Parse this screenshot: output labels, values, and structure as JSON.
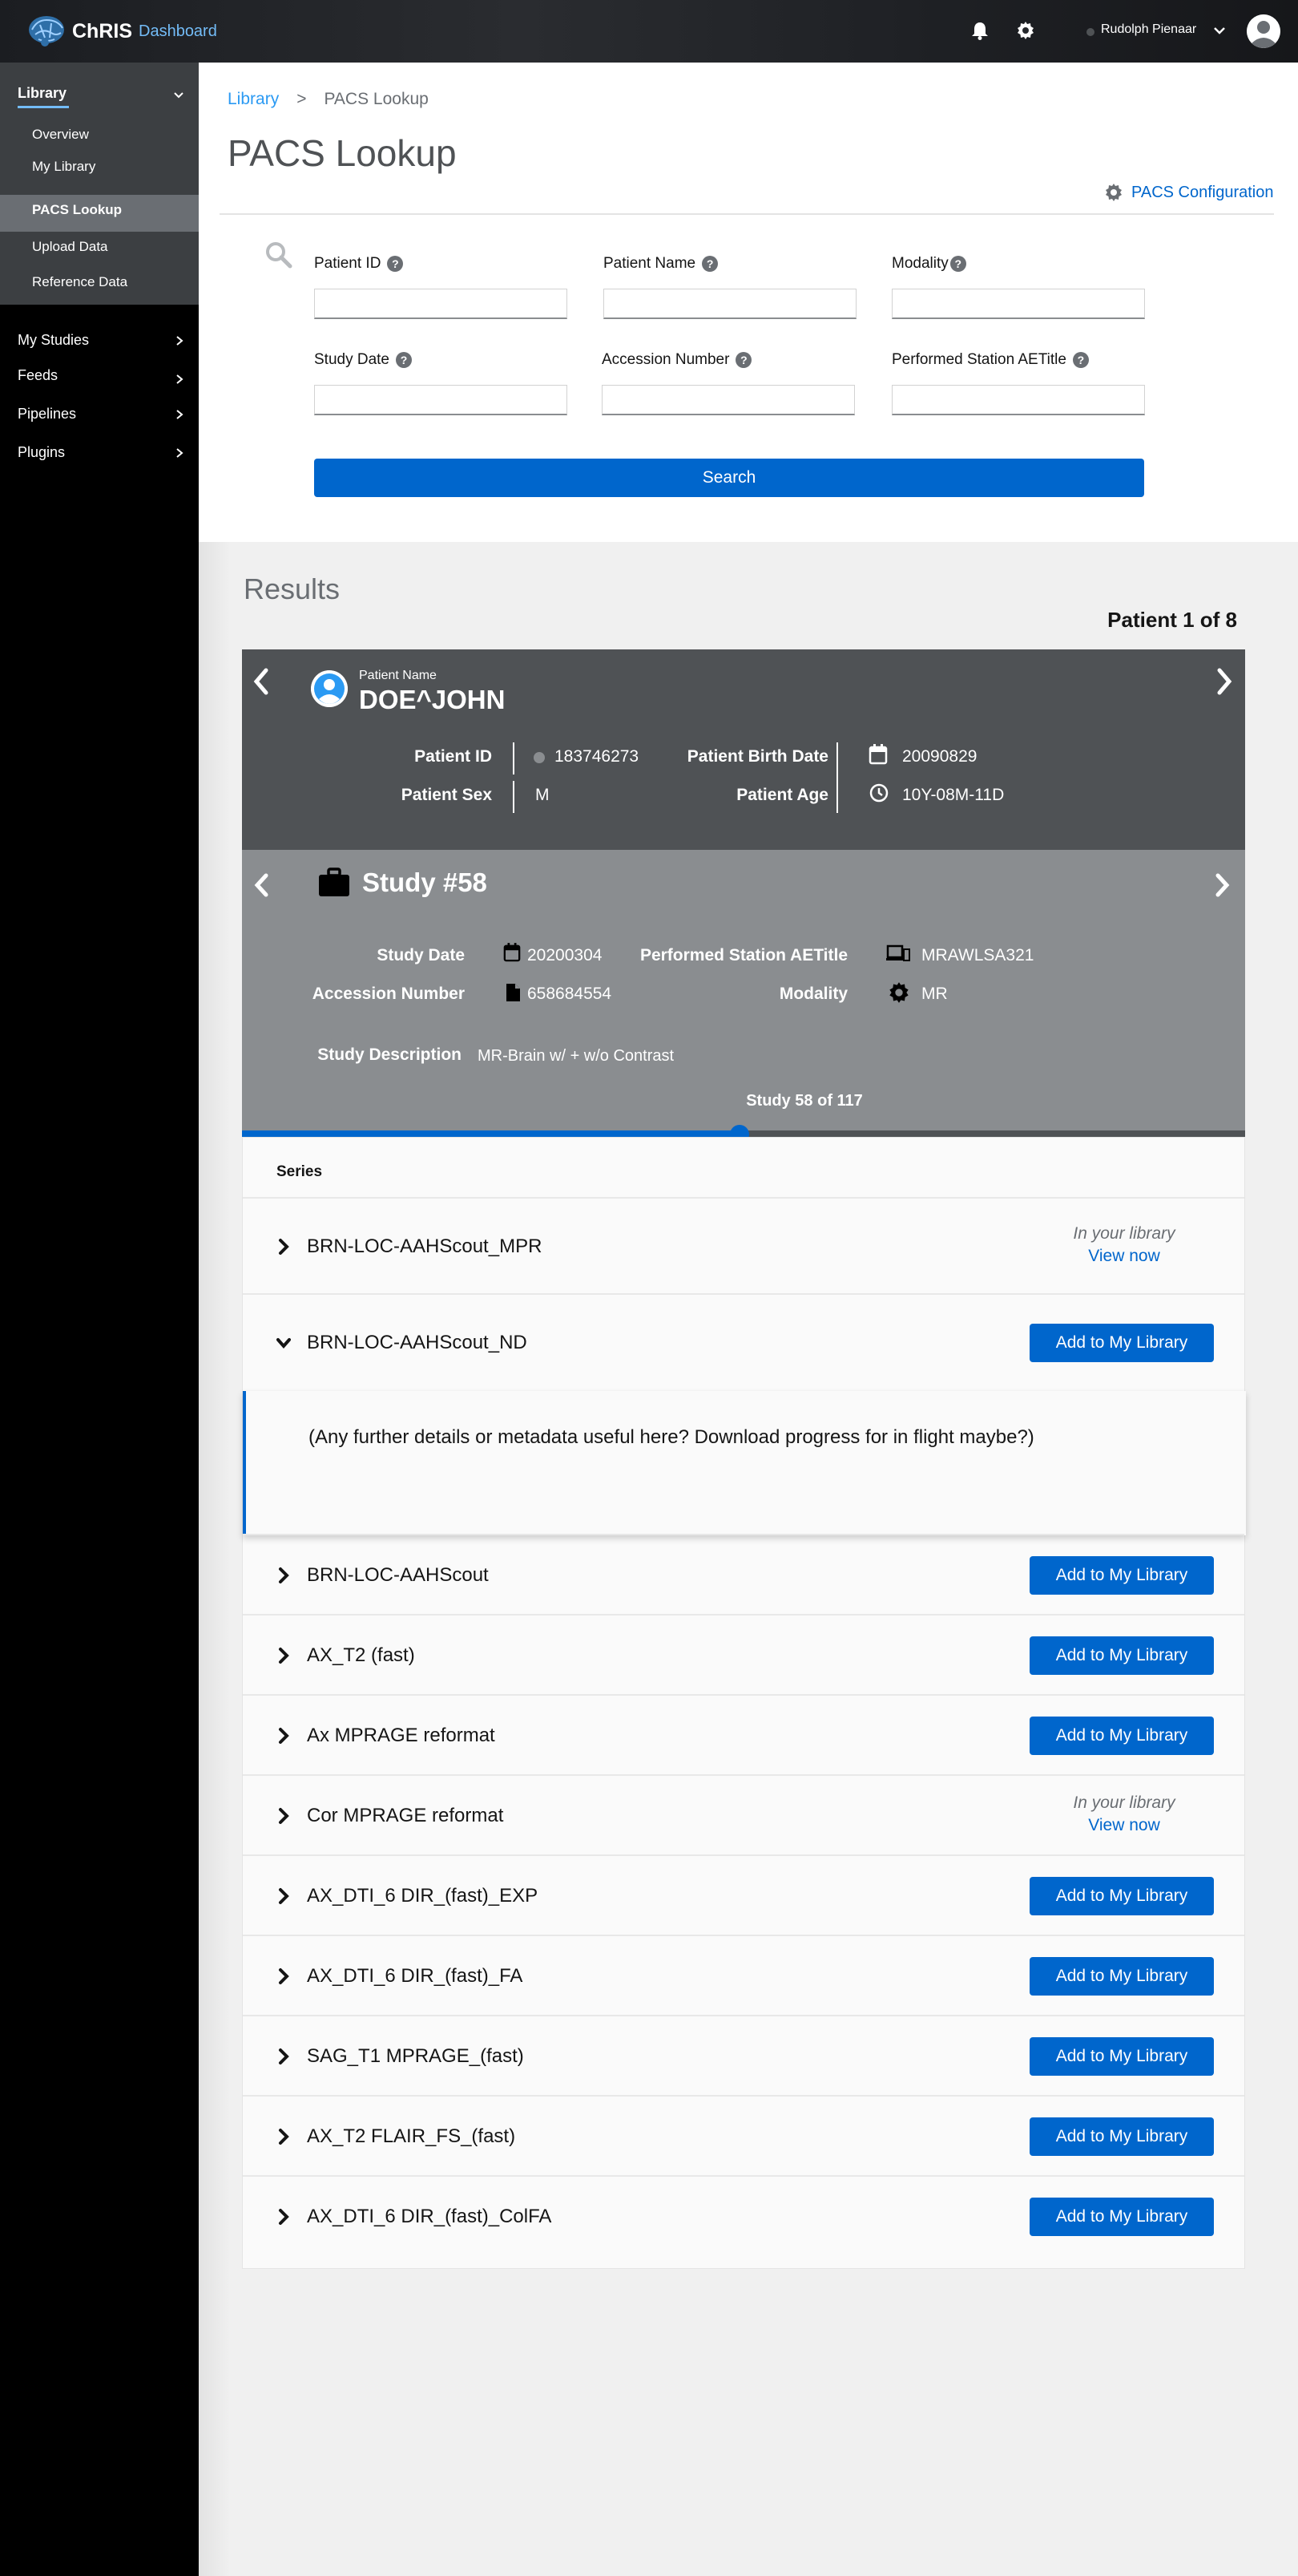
{
  "topbar": {
    "brand_name": "ChRIS",
    "brand_sub": "Dashboard",
    "user_name": "Rudolph Pienaar"
  },
  "sidebar": {
    "group_label": "Library",
    "sub_items": [
      "Overview",
      "My Library",
      "PACS Lookup",
      "Upload Data",
      "Reference Data"
    ],
    "active_item": "PACS Lookup",
    "main_items": [
      "My Studies",
      "Feeds",
      "Pipelines",
      "Plugins"
    ]
  },
  "breadcrumb": {
    "root": "Library",
    "separator": ">",
    "current": "PACS Lookup"
  },
  "page": {
    "title": "PACS Lookup",
    "config_link": "PACS Configuration"
  },
  "form": {
    "patient_id": {
      "label": "Patient ID",
      "value": ""
    },
    "patient_name": {
      "label": "Patient Name",
      "value": ""
    },
    "modality": {
      "label": "Modality",
      "value": ""
    },
    "study_date": {
      "label": "Study Date",
      "value": ""
    },
    "accession_number": {
      "label": "Accession Number",
      "value": ""
    },
    "station_aetitle": {
      "label": "Performed Station AETitle",
      "value": ""
    },
    "help_glyph": "?",
    "search_label": "Search"
  },
  "results": {
    "title": "Results",
    "patient_count": "Patient 1 of 8"
  },
  "patient": {
    "name_label": "Patient Name",
    "name": "DOE^JOHN",
    "id_label": "Patient ID",
    "id": "183746273",
    "birth_label": "Patient Birth Date",
    "birth": "20090829",
    "sex_label": "Patient Sex",
    "sex": "M",
    "age_label": "Patient Age",
    "age": "10Y-08M-11D"
  },
  "study": {
    "title": "Study #58",
    "date_label": "Study Date",
    "date": "20200304",
    "station_label": "Performed Station AETitle",
    "station": "MRAWLSA321",
    "accession_label": "Accession Number",
    "accession": "658684554",
    "modality_label": "Modality",
    "modality": "MR",
    "desc_label": "Study Description",
    "desc": "MR-Brain w/ + w/o Contrast",
    "count_text": "Study 58 of 117",
    "progress_fraction": 0.4957
  },
  "series": {
    "header": "Series",
    "add_label": "Add to My Library",
    "in_library_label": "In your library",
    "view_now_label": "View now",
    "details_text": "(Any further details or metadata useful here? Download progress for in flight maybe?)",
    "items": [
      {
        "name": "BRN-LOC-AAHScout_MPR",
        "in_library": true,
        "expanded": false
      },
      {
        "name": "BRN-LOC-AAHScout_ND",
        "in_library": false,
        "expanded": true
      },
      {
        "name": "BRN-LOC-AAHScout",
        "in_library": false,
        "expanded": false
      },
      {
        "name": "AX_T2 (fast)",
        "in_library": false,
        "expanded": false
      },
      {
        "name": "Ax MPRAGE reformat",
        "in_library": false,
        "expanded": false
      },
      {
        "name": "Cor MPRAGE reformat",
        "in_library": true,
        "expanded": false
      },
      {
        "name": "AX_DTI_6 DIR_(fast)_EXP",
        "in_library": false,
        "expanded": false
      },
      {
        "name": "AX_DTI_6 DIR_(fast)_FA",
        "in_library": false,
        "expanded": false
      },
      {
        "name": "SAG_T1 MPRAGE_(fast)",
        "in_library": false,
        "expanded": false
      },
      {
        "name": "AX_T2 FLAIR_FS_(fast)",
        "in_library": false,
        "expanded": false
      },
      {
        "name": "AX_DTI_6 DIR_(fast)_ColFA",
        "in_library": false,
        "expanded": false
      }
    ]
  },
  "colors": {
    "primary": "#0066cc",
    "link": "#2b9af3",
    "patient_bg": "#4f5255",
    "study_bg": "#8a8d90",
    "sidebar_bg": "#000000",
    "sidebar_group_bg": "#3c3f42"
  }
}
